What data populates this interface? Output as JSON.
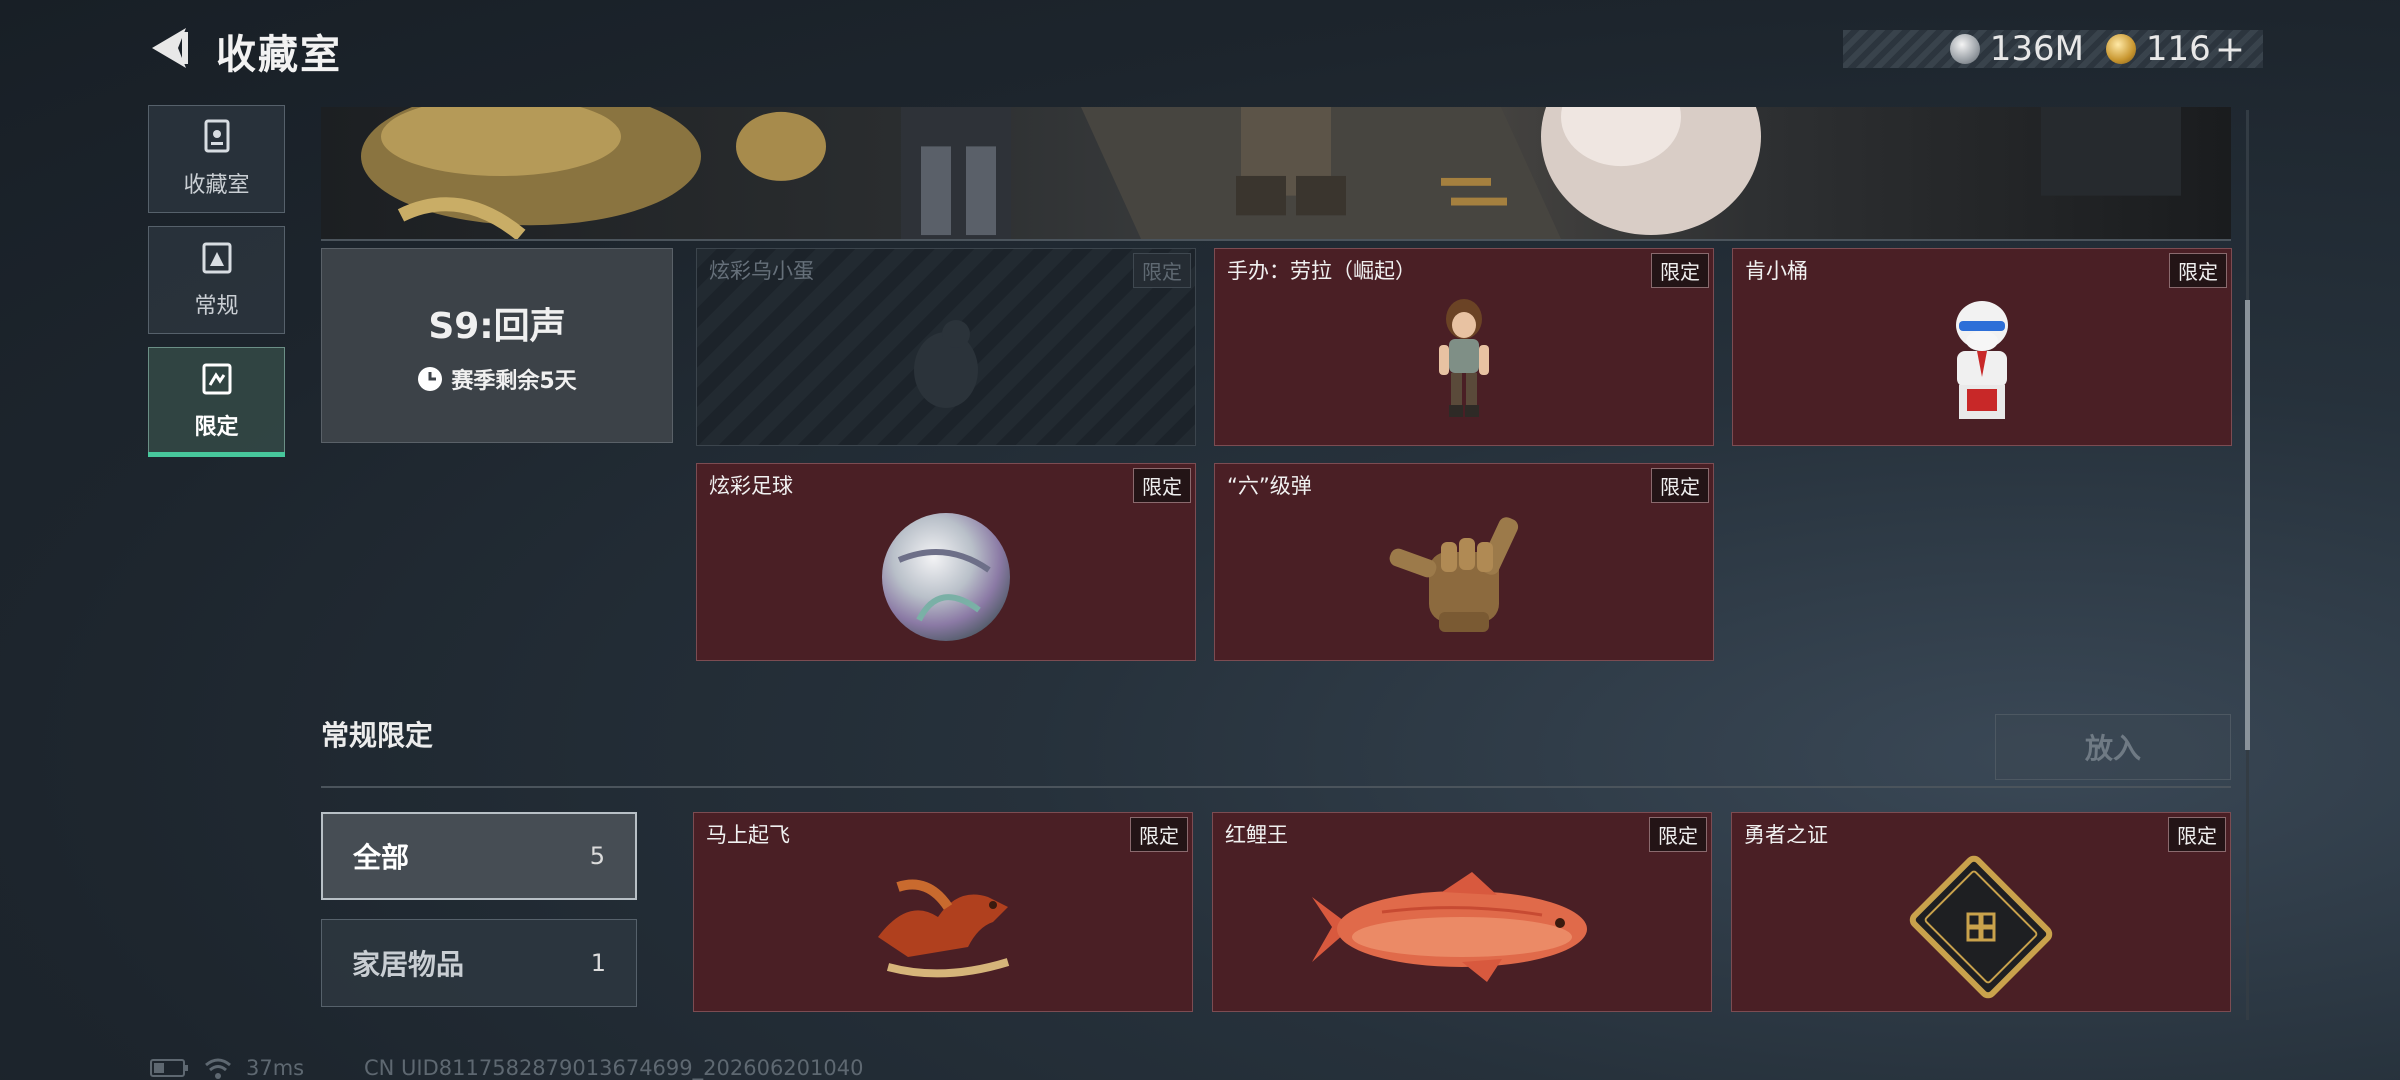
{
  "header": {
    "title": "收藏室",
    "currencies": [
      {
        "icon": "silver-coin-icon",
        "value": "136M"
      },
      {
        "icon": "gold-coin-icon",
        "value": "116"
      }
    ],
    "add_symbol": "+"
  },
  "nav": {
    "items": [
      {
        "label": "收藏室",
        "icon": "trophy-cabinet-icon",
        "active": false
      },
      {
        "label": "常规",
        "icon": "frame-icon",
        "active": false
      },
      {
        "label": "限定",
        "icon": "limited-frame-icon",
        "active": true
      }
    ]
  },
  "season": {
    "title": "S9:回声",
    "remaining": "赛季剩余5天"
  },
  "limited_items": [
    {
      "name": "炫彩乌小蛋",
      "tag": "限定",
      "locked": true,
      "icon": "egg-silhouette-icon"
    },
    {
      "name": "手办：劳拉（崛起）",
      "tag": "限定",
      "locked": false,
      "icon": "lara-figure-icon"
    },
    {
      "name": "肯小桶",
      "tag": "限定",
      "locked": false,
      "icon": "colonel-figure-icon"
    },
    {
      "name": "炫彩足球",
      "tag": "限定",
      "locked": false,
      "icon": "iridescent-ball-icon"
    },
    {
      "name": "“六”级弹",
      "tag": "限定",
      "locked": false,
      "icon": "shaka-hand-icon"
    }
  ],
  "regular_section": {
    "title": "常规限定",
    "put_in_label": "放入",
    "categories": [
      {
        "label": "全部",
        "count": "5",
        "active": true
      },
      {
        "label": "家居物品",
        "count": "1",
        "active": false
      }
    ],
    "items": [
      {
        "name": "马上起飞",
        "tag": "限定",
        "icon": "golden-horse-icon"
      },
      {
        "name": "红鲤王",
        "tag": "限定",
        "icon": "red-carp-icon"
      },
      {
        "name": "勇者之证",
        "tag": "限定",
        "icon": "gold-card-icon"
      }
    ]
  },
  "status_bar": {
    "ping": "37ms",
    "uid": "CN UID8117582879013674699_202606201040"
  },
  "colors": {
    "accent": "#47c79c",
    "card_bg": "#4a1f25",
    "background": "#1d252d"
  }
}
